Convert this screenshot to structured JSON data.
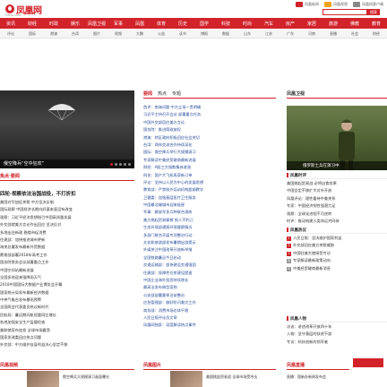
{
  "header": {
    "logo_text": "凤凰网",
    "logo_sub": "IFENG.COM",
    "top_links": [
      "凤凰新闻",
      "凤凰视频",
      "凤凰网客户端"
    ],
    "search_placeholder": "",
    "search_button": "搜索"
  },
  "nav": {
    "items": [
      "资讯",
      "财经",
      "时政",
      "娱乐",
      "凤凰卫视",
      "军事",
      "凤凰",
      "体育",
      "历史",
      "国学",
      "科技",
      "时尚",
      "汽车",
      "房产",
      "家居",
      "旅游",
      "佛教",
      "教育"
    ]
  },
  "subnav": {
    "items": [
      "评论",
      "国际",
      "港澳",
      "台湾",
      "图片",
      "视频",
      "大鹏",
      "公益",
      "读书",
      "博报",
      "数据",
      "山东",
      "江苏",
      "广东",
      "河南",
      "直播",
      "社会",
      "财经"
    ]
  },
  "hero": {
    "caption": "俄空降兵“空中狂欢”",
    "dots": 5,
    "active_dot": 0
  },
  "left": {
    "section_title": "焦点·要闻",
    "headline": "四轮·视察依法治国战役，不打折扣",
    "items": [
      "美国对华加征关税 中方坚决反制",
      "国际观察 中国经济长期向好基本面没有改变",
      "观察：习近平经济思想指引中国高质量发展",
      "外交部就美方言论作出回应 坚决反对",
      "多地出台新政 稳楼市促消费",
      "住建部：加快推进城市更新",
      "海关总署发布最新外贸数据",
      "教育部部署2018年高考工作",
      "国务院常务会议部署重点工作",
      "中国空间站最新进展",
      "全国多地迎来强降雨天气",
      "2018中国国际大数据产业博览会开幕",
      "国家统计局发布最新经济数据",
      "中央气象台发布暴雨预警",
      "全国两会代表委员热议新时代",
      "民航局：暑运期间航班量同比增长",
      "各地加强安全生产监督检查",
      "美联储宣布加息 全球市场震荡",
      "国家发改委回应热点问题",
      "外交部：中方维护自身利益决心坚定不移"
    ]
  },
  "middle": {
    "tabs": [
      "要闻",
      "热点",
      "专题"
    ],
    "items": [
      "首评：南海问题 中方立场一贯明确",
      "习近平主持召开会议 部署重点任务",
      "中国外交部回应美方言论",
      "国务院：推进简政放权",
      "港澳：特区政府积极回应社会关切",
      "台湾：两岸交流合作持续深化",
      "国际：俄空降兵举行大规模演习",
      "专家解读中美经贸磋商最新进展",
      "财经：A股三大指数集体收涨",
      "科技：国产大飞机再获新订单",
      "评论：坚持以人民为中心的发展思想",
      "教育部：严禁校外培训机构超纲教学",
      "卫健委：加强基层医疗卫生服务",
      "中国最北端城市迎来极昼",
      "军事：解放军多兵种联合演练",
      "美方挑起贸易摩擦 损人不利己",
      "生态环境部通报环保督察情况",
      "多部门联合开展专项整治行动",
      "文化和旅游部发布暑期出游提示",
      "外媒关注中国改革开放新举措",
      "全国铁路暑运今日启动",
      "交通运输部：加快建设交通强国",
      "住建部：保障性住房建设提速",
      "中国企业海外投资持续增长",
      "最高法发布典型案例",
      "公安部部署夏季治安整治",
      "应急管理部：做好防汛救灾工作",
      "商务部：消费市场总体平稳",
      "人民日报评论员文章",
      "凤凰网独家：深度解读热点事件"
    ]
  },
  "right": {
    "section_title": "凤凰卫视",
    "photo_caption": "俄罗斯士兵在演习中",
    "sub1": "凤凰时评",
    "sub1_items": [
      "美国挑起贸易战 必将自食其果",
      "中国坚定不移扩大对外开放",
      "凤凰评论：理性看待中美关系",
      "专家：中国经济韧性强潜力足",
      "观察：全球化进程不可逆转",
      "时评：推动构建人类命运共同体"
    ],
    "sub2": "凤凰热议",
    "sub2_items": [
      "人民日报：坚决维护国家利益",
      "外交部回应美方关税威胁",
      "中国驻美大使接受专访",
      "专家解读最新政策动向",
      "中美经贸磋商最新消息"
    ],
    "sub3": "凤凰人物",
    "sub3_items": [
      "访谈：讲述改革开放四十年",
      "人物：坚守基层的扶贫干部",
      "专访：科技创新的领军者"
    ]
  },
  "bottom": {
    "heads": [
      "凤凰视频",
      "凤凰图片",
      "凤凰直播"
    ],
    "texts": [
      "俄空降兵大规模演习画面曝光",
      "美国挑起贸易战 全球市场受冲击",
      "直播：国新办新闻发布会"
    ]
  },
  "colors": {
    "accent": "#d2232a",
    "link_blue": "#2a4d9b"
  }
}
